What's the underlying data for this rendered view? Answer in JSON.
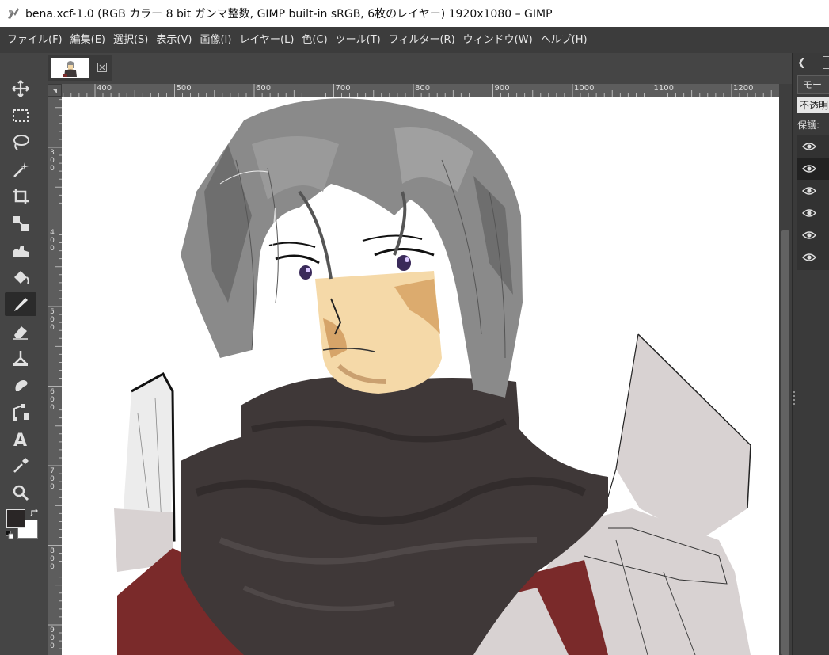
{
  "window": {
    "title": "bena.xcf-1.0 (RGB カラー 8 bit ガンマ整数, GIMP built-in sRGB, 6枚のレイヤー) 1920x1080 – GIMP"
  },
  "menu": [
    "ファイル(F)",
    "編集(E)",
    "選択(S)",
    "表示(V)",
    "画像(I)",
    "レイヤー(L)",
    "色(C)",
    "ツール(T)",
    "フィルター(R)",
    "ウィンドウ(W)",
    "ヘルプ(H)"
  ],
  "toolbox": {
    "tools": [
      {
        "name": "move-tool-icon",
        "active": false
      },
      {
        "name": "rect-select-tool-icon",
        "active": false
      },
      {
        "name": "lasso-tool-icon",
        "active": false
      },
      {
        "name": "fuzzy-select-tool-icon",
        "active": false
      },
      {
        "name": "crop-tool-icon",
        "active": false
      },
      {
        "name": "unified-transform-tool-icon",
        "active": false
      },
      {
        "name": "warp-transform-tool-icon",
        "active": false
      },
      {
        "name": "bucket-fill-tool-icon",
        "active": false
      },
      {
        "name": "paintbrush-tool-icon",
        "active": true
      },
      {
        "name": "eraser-tool-icon",
        "active": false
      },
      {
        "name": "clone-tool-icon",
        "active": false
      },
      {
        "name": "smudge-tool-icon",
        "active": false
      },
      {
        "name": "paths-tool-icon",
        "active": false
      },
      {
        "name": "text-tool-icon",
        "active": false
      },
      {
        "name": "color-picker-tool-icon",
        "active": false
      },
      {
        "name": "zoom-tool-icon",
        "active": false
      }
    ],
    "fg_color": "#2a2626",
    "bg_color": "#ffffff"
  },
  "hruler": {
    "labels": [
      "400",
      "500",
      "600",
      "700",
      "800",
      "900",
      "1000",
      "1100",
      "1200"
    ]
  },
  "vruler": {
    "labels": [
      "300",
      "400",
      "500",
      "600",
      "700",
      "800",
      "900"
    ]
  },
  "dock": {
    "mode_label": "モー",
    "opacity_label": "不透明",
    "protect_label": "保護:",
    "layers": [
      {
        "visible": true,
        "selected": false
      },
      {
        "visible": true,
        "selected": true
      },
      {
        "visible": true,
        "selected": false
      },
      {
        "visible": true,
        "selected": false
      },
      {
        "visible": true,
        "selected": false
      },
      {
        "visible": true,
        "selected": false
      }
    ]
  },
  "colors": {
    "hair": "#8a8a8a",
    "skin": "#f5d9a8",
    "scarf": "#3f3838",
    "coat_red": "#7a2a2a",
    "armor": "#d8d2d2"
  }
}
